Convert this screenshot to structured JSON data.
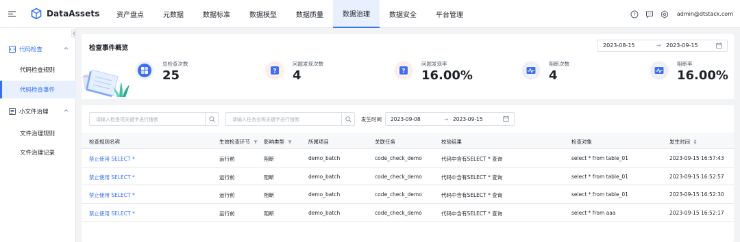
{
  "app": {
    "title": "DataAssets"
  },
  "nav": {
    "items": [
      "资产盘点",
      "元数据",
      "数据标准",
      "数据模型",
      "数据质量",
      "数据治理",
      "数据安全",
      "平台管理"
    ],
    "active": "数据治理"
  },
  "user": {
    "email": "admin@dtstack.com"
  },
  "sidebar": {
    "groups": [
      {
        "title": "代码检查",
        "items": [
          "代码检查规则",
          "代码检查事件"
        ]
      },
      {
        "title": "小文件治理",
        "items": [
          "文件治理规则",
          "文件治理记录"
        ]
      }
    ],
    "active_item": "代码检查事件"
  },
  "overview": {
    "title": "检查事件概览",
    "date_start": "2023-08-15",
    "date_end": "2023-09-15",
    "arrow": "→",
    "stats": [
      {
        "label": "总检查次数",
        "value": "25",
        "icon": "grid-blocks-icon"
      },
      {
        "label": "问题发现次数",
        "value": "4",
        "icon": "question-icon"
      },
      {
        "label": "问题发现率",
        "value": "16.00%",
        "icon": "question-icon"
      },
      {
        "label": "阻断次数",
        "value": "4",
        "icon": "pulse-chart-icon"
      },
      {
        "label": "阻断率",
        "value": "16.00%",
        "icon": "pulse-chart-icon"
      }
    ]
  },
  "filters": {
    "rule_search_placeholder": "请输入检查项关键字进行搜索",
    "task_search_placeholder": "请输入任务名称关键字进行搜索",
    "occurrence_label": "发生时间",
    "date_start": "2023-09-08",
    "date_end": "2023-09-15",
    "arrow": "→"
  },
  "table": {
    "headers": [
      "检查规则名称",
      "生效检查环节",
      "影响类型",
      "所属项目",
      "关联任务",
      "校验结果",
      "检查对象",
      "发生时间"
    ],
    "rows": [
      [
        "禁止使用 SELECT *",
        "运行前",
        "阻断",
        "demo_batch",
        "code_check_demo",
        "代码中含有SELECT * 查询",
        "select * from table_01",
        "2023-09-15 16:57:43"
      ],
      [
        "禁止使用 SELECT *",
        "运行前",
        "阻断",
        "demo_batch",
        "code_check_demo",
        "代码中含有SELECT * 查询",
        "select * from table_01",
        "2023-09-15 16:52:57"
      ],
      [
        "禁止使用 SELECT *",
        "运行前",
        "阻断",
        "demo_batch",
        "code_check_demo",
        "代码中含有SELECT * 查询",
        "select * from table_01",
        "2023-09-15 16:52:30"
      ],
      [
        "禁止使用 SELECT *",
        "运行前",
        "阻断",
        "demo_batch",
        "code_check_demo",
        "代码中含有SELECT * 查询",
        "select * from aaa",
        "2023-09-15 16:52:17"
      ]
    ]
  },
  "colors": {
    "accent": "#3370ff",
    "active_bg": "#e8f0fe",
    "page_bg": "#f2f3f5"
  }
}
